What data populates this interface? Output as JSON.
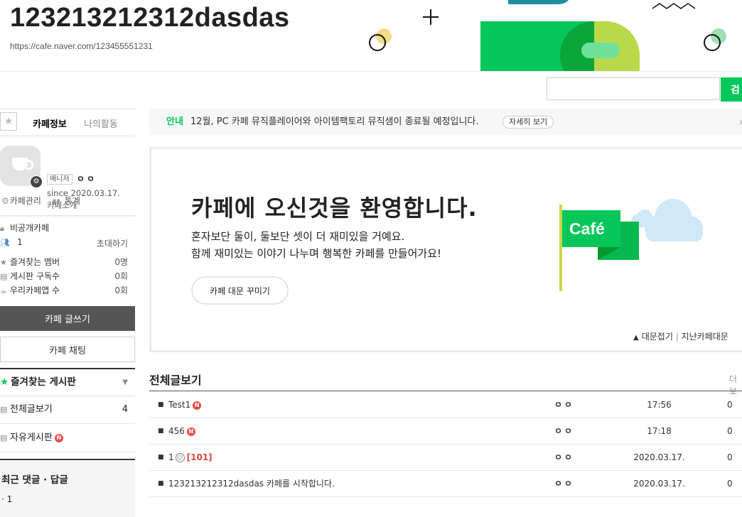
{
  "header": {
    "cafe_name": "123213212312dasdas",
    "cafe_url": "https://cafe.naver.com/123455551231"
  },
  "search": {
    "value": "",
    "button_label": "검"
  },
  "sidebar": {
    "tabs": [
      "카페정보",
      "나의활동"
    ],
    "manager_badge": "매니저",
    "manager_name": "ㅇㅇ",
    "since": "since 2020.03.17.",
    "intro_link": "카페소개",
    "manage_link": "카페관리",
    "stats_link": "통계",
    "privacy": "비공개카페",
    "member_count": "1",
    "invite_link": "초대하기",
    "stats": [
      {
        "label": "즐겨찾는 멤버",
        "value": "0명",
        "icon": "star-icon"
      },
      {
        "label": "게시판 구독수",
        "value": "0회",
        "icon": "rss-icon"
      },
      {
        "label": "우리카페앱 수",
        "value": "0회",
        "icon": "cup-icon"
      }
    ],
    "write_button": "카페 글쓰기",
    "chat_button": "카페 채팅",
    "favorites_title": "즐겨찾는 게시판",
    "boards": [
      {
        "label": "전체글보기",
        "count": "4",
        "new": false
      },
      {
        "label": "자유게시판",
        "count": "",
        "new": true
      }
    ],
    "recent_title": "최근 댓글 · 답글",
    "recent_items": [
      "1"
    ]
  },
  "notice": {
    "tag": "안내",
    "text": "12월, PC 카페 뮤직플레이어와 아이템팩토리 뮤직샘이 종료될 예정입니다.",
    "more": "자세히 보기"
  },
  "welcome": {
    "title": "카페에 오신것을 환영합니다.",
    "line1": "혼자보단 둘이, 둘보단 셋이 더 재미있을 거예요.",
    "line2": "함께 재미있는 이야기 나누며 행복한 카페를 만들어가요!",
    "decorate_button": "카페 대문 꾸미기",
    "fold_link": "대문접기",
    "separator": "|",
    "past_link": "지난카페대문",
    "flag_text": "Café"
  },
  "posts_section": {
    "title": "전체글보기",
    "more": "더보",
    "rows": [
      {
        "title": "Test1",
        "new": true,
        "comment_count": "",
        "author": "ㅇㅇ",
        "date": "17:56",
        "views": "0"
      },
      {
        "title": "456",
        "new": true,
        "comment_count": "",
        "author": "ㅇㅇ",
        "date": "17:18",
        "views": "0"
      },
      {
        "title": "1",
        "new": false,
        "comment_count": "[101]",
        "author": "ㅇㅇ",
        "date": "2020.03.17.",
        "views": "0"
      },
      {
        "title": "123213212312dasdas 카페를 시작합니다.",
        "new": false,
        "comment_count": "",
        "author": "ㅇㅇ",
        "date": "2020.03.17.",
        "views": "0"
      }
    ]
  },
  "colors": {
    "accent_green": "#03c75a",
    "new_badge_red": "#f04a4a",
    "comment_red": "#e54242"
  }
}
